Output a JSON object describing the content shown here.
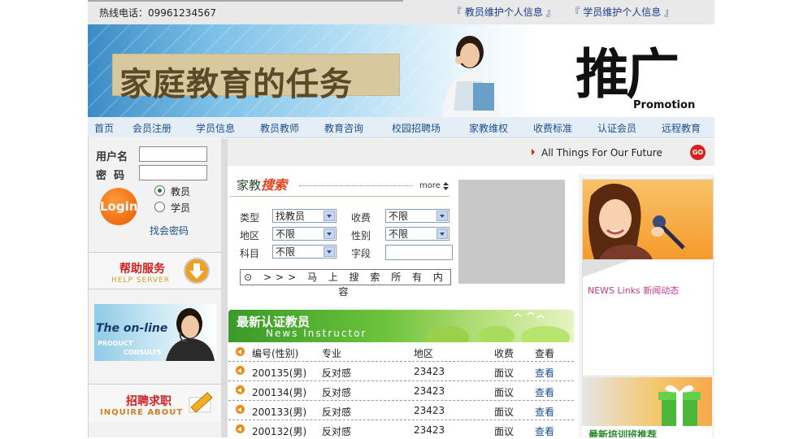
{
  "topbar": {
    "hotline": "热线电话：09961234567",
    "links": [
      "『 教员维护个人信息 』",
      "『 学员维护个人信息 』"
    ]
  },
  "banner": {
    "title": "家庭教育的任务",
    "calligraphy": "推广",
    "promotion": "Promotion"
  },
  "nav": {
    "items": [
      "首页",
      "会员注册",
      "学员信息",
      "教员教师",
      "教育咨询",
      "校园招聘场",
      "家教维权",
      "收费标准",
      "认证会员",
      "远程教育"
    ]
  },
  "login": {
    "username_label": "用户名",
    "password_label": "密  码",
    "login_button": "Login",
    "role_teacher": "教员",
    "role_student": "学员",
    "forgot_password": "找会密码"
  },
  "sidebar": {
    "help_cn": "帮助服务",
    "help_en": "HELP SERVER",
    "online_title": "The on-line",
    "online_sub1": "PRODUCT",
    "online_sub2": "CONSULTS",
    "recruit_cn": "招聘求职",
    "recruit_en": "INQUIRE ABOUT"
  },
  "tagline": {
    "text": "All Things For Our Future",
    "go": "GO"
  },
  "search": {
    "title_a": "家教",
    "title_b": "搜索",
    "more": "more",
    "type_label": "类型",
    "type_value": "找教员",
    "fee_label": "收费",
    "fee_value": "不限",
    "area_label": "地区",
    "area_value": "不限",
    "gender_label": "性别",
    "gender_value": "不限",
    "subject_label": "科目",
    "subject_value": "不限",
    "field_label": "字段",
    "field_value": "",
    "submit": "⊙ >>> 马 上 搜 索 所 有 内 容"
  },
  "teachers": {
    "title_cn": "最新认证教员",
    "title_en": "News Instructor",
    "headers": [
      "编号(性别)",
      "专业",
      "地区",
      "收费",
      "查看"
    ],
    "rows": [
      {
        "id": "200135(男)",
        "major": "反对感",
        "area": "23423",
        "fee": "面议",
        "view": "查看"
      },
      {
        "id": "200134(男)",
        "major": "反对感",
        "area": "23423",
        "fee": "面议",
        "view": "查看"
      },
      {
        "id": "200133(男)",
        "major": "反对感",
        "area": "23423",
        "fee": "面议",
        "view": "查看"
      },
      {
        "id": "200132(男)",
        "major": "反对感",
        "area": "23423",
        "fee": "面议",
        "view": "查看"
      }
    ]
  },
  "rightcol": {
    "news_label": "NEWS Links 新闻动态",
    "training_label": "最新培训班推荐"
  }
}
